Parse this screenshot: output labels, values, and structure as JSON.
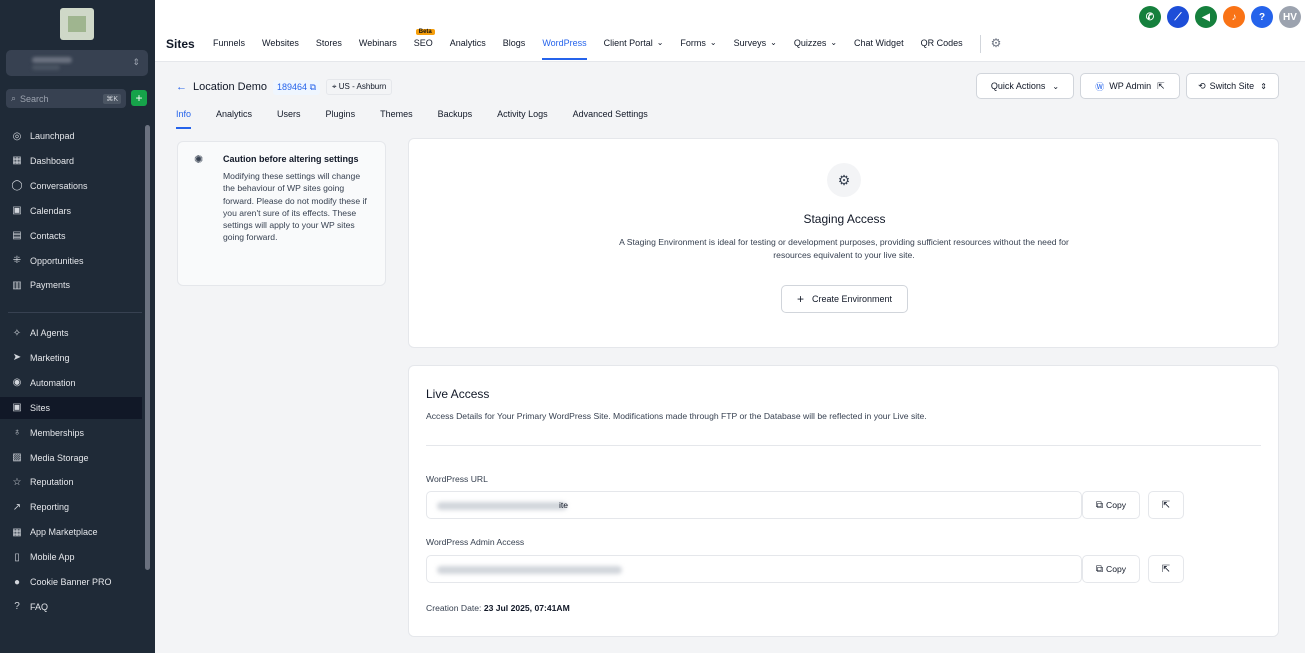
{
  "sidebar": {
    "search_placeholder": "Search",
    "search_shortcut": "⌘K",
    "items_top": [
      {
        "label": "Launchpad",
        "icon": "rocket-icon",
        "glyph": "◎"
      },
      {
        "label": "Dashboard",
        "icon": "dashboard-icon",
        "glyph": "▦"
      },
      {
        "label": "Conversations",
        "icon": "chat-icon",
        "glyph": "◯"
      },
      {
        "label": "Calendars",
        "icon": "calendar-icon",
        "glyph": "▣"
      },
      {
        "label": "Contacts",
        "icon": "contacts-icon",
        "glyph": "▤"
      },
      {
        "label": "Opportunities",
        "icon": "opportunities-icon",
        "glyph": "⁜"
      },
      {
        "label": "Payments",
        "icon": "payments-icon",
        "glyph": "▥"
      }
    ],
    "items_bottom": [
      {
        "label": "AI Agents",
        "icon": "ai-agents-icon",
        "glyph": "✧"
      },
      {
        "label": "Marketing",
        "icon": "marketing-icon",
        "glyph": "➤"
      },
      {
        "label": "Automation",
        "icon": "automation-icon",
        "glyph": "◉"
      },
      {
        "label": "Sites",
        "icon": "sites-icon",
        "glyph": "▣",
        "active": true
      },
      {
        "label": "Memberships",
        "icon": "memberships-icon",
        "glyph": "♁"
      },
      {
        "label": "Media Storage",
        "icon": "media-storage-icon",
        "glyph": "▨"
      },
      {
        "label": "Reputation",
        "icon": "reputation-icon",
        "glyph": "☆"
      },
      {
        "label": "Reporting",
        "icon": "reporting-icon",
        "glyph": "↗"
      },
      {
        "label": "App Marketplace",
        "icon": "app-marketplace-icon",
        "glyph": "▦"
      },
      {
        "label": "Mobile App",
        "icon": "mobile-app-icon",
        "glyph": "▯"
      },
      {
        "label": "Cookie Banner PRO",
        "icon": "cookie-icon",
        "glyph": "●"
      },
      {
        "label": "FAQ",
        "icon": "faq-icon",
        "glyph": "?"
      }
    ]
  },
  "topbar": {
    "title": "Sites",
    "nav": [
      {
        "label": "Funnels"
      },
      {
        "label": "Websites"
      },
      {
        "label": "Stores"
      },
      {
        "label": "Webinars"
      },
      {
        "label": "SEO",
        "badge": "Beta"
      },
      {
        "label": "Analytics"
      },
      {
        "label": "Blogs"
      },
      {
        "label": "WordPress",
        "active": true
      },
      {
        "label": "Client Portal",
        "dropdown": true
      },
      {
        "label": "Forms",
        "dropdown": true
      },
      {
        "label": "Surveys",
        "dropdown": true
      },
      {
        "label": "Quizzes",
        "dropdown": true
      },
      {
        "label": "Chat Widget"
      },
      {
        "label": "QR Codes"
      }
    ],
    "icons": [
      {
        "name": "phone-icon",
        "glyph": "✆",
        "color": "#15803d"
      },
      {
        "name": "link-icon",
        "glyph": "⟋",
        "color": "#1d4ed8"
      },
      {
        "name": "megaphone-icon",
        "glyph": "◀",
        "color": "#15803d"
      },
      {
        "name": "bell-icon",
        "glyph": "♪",
        "color": "#f97316"
      },
      {
        "name": "help-icon",
        "glyph": "?",
        "color": "#2563eb"
      },
      {
        "name": "avatar",
        "glyph": "HV",
        "color": "#9ca3af"
      }
    ]
  },
  "location": {
    "name": "Location Demo",
    "id": "189464",
    "region": "US - Ashburn"
  },
  "header_buttons": {
    "quick_actions": "Quick Actions",
    "wp_admin": "WP Admin",
    "switch_site": "Switch Site"
  },
  "subtabs": [
    {
      "label": "Info",
      "active": true
    },
    {
      "label": "Analytics"
    },
    {
      "label": "Users"
    },
    {
      "label": "Plugins"
    },
    {
      "label": "Themes"
    },
    {
      "label": "Backups"
    },
    {
      "label": "Activity Logs"
    },
    {
      "label": "Advanced Settings"
    }
  ],
  "caution": {
    "title": "Caution before altering settings",
    "body": "Modifying these settings will change the behaviour of WP sites going forward. Please do not modify these if you aren't sure of its effects. These settings will apply to your WP sites going forward."
  },
  "staging": {
    "title": "Staging Access",
    "description": "A Staging Environment is ideal for testing or development purposes, providing sufficient resources without the need for resources equivalent to your live site.",
    "button": "Create Environment"
  },
  "live": {
    "title": "Live Access",
    "description": "Access Details for Your Primary WordPress Site. Modifications made through FTP or the Database will be reflected in your Live site.",
    "url_label": "WordPress URL",
    "url_suffix": "ite",
    "admin_label": "WordPress Admin Access",
    "copy": "Copy",
    "creation_label": "Creation Date:",
    "creation_value": "23 Jul 2025, 07:41AM"
  }
}
